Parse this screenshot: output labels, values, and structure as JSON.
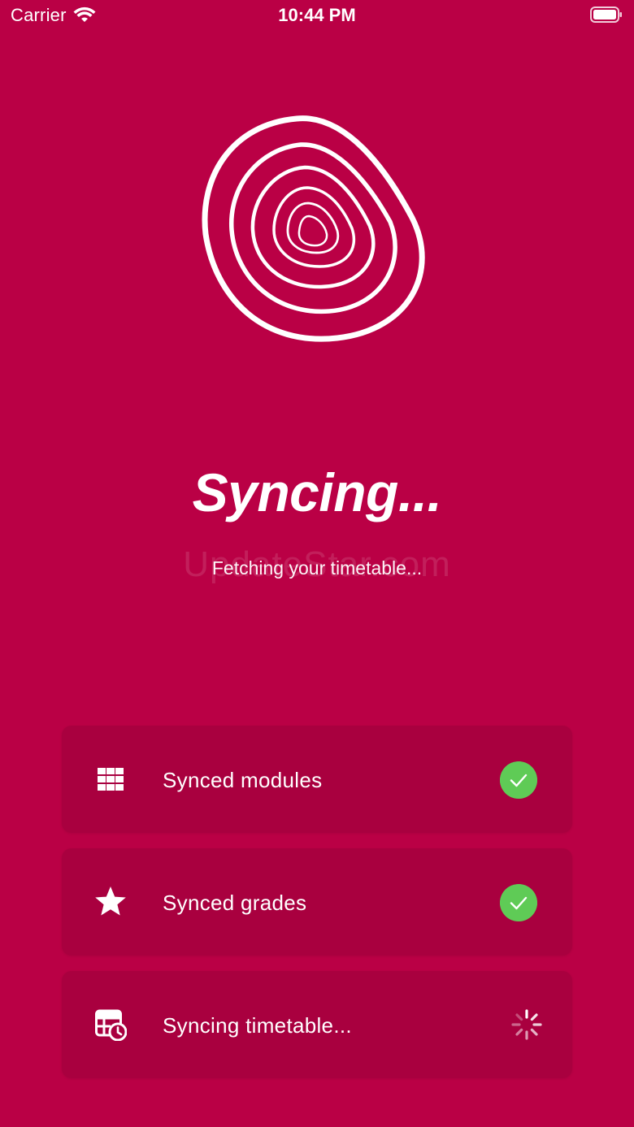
{
  "status_bar": {
    "carrier": "Carrier",
    "time": "10:44 PM"
  },
  "main": {
    "title": "Syncing...",
    "subtitle": "Fetching your timetable...",
    "watermark": "UpdateStar.com"
  },
  "sync_items": [
    {
      "label": "Synced modules",
      "icon": "grid-icon",
      "status": "done"
    },
    {
      "label": "Synced grades",
      "icon": "star-icon",
      "status": "done"
    },
    {
      "label": "Syncing timetable...",
      "icon": "timetable-clock-icon",
      "status": "in-progress"
    }
  ],
  "colors": {
    "background": "#BA0045",
    "card": "#A9003F",
    "check": "#5FCB56",
    "text": "#FFFFFF"
  }
}
